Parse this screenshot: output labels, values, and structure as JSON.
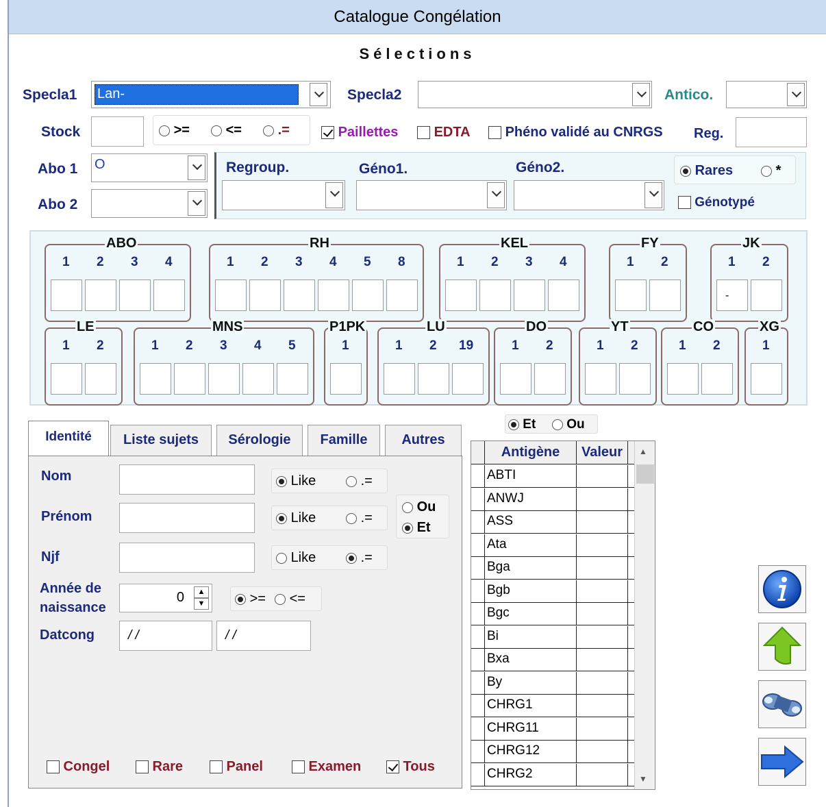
{
  "window": {
    "title": "Catalogue Congélation",
    "section_title": "Sélections"
  },
  "top": {
    "specla1_label": "Specla1",
    "specla1_value": "Lan-",
    "specla2_label": "Specla2",
    "specla2_value": "",
    "antico_label": "Antico.",
    "antico_value": "",
    "stock_label": "Stock",
    "cmp_ge": ">=",
    "cmp_le": "<=",
    "cmp_eq": ".=",
    "paillettes_label": "Paillettes",
    "paillettes_checked": true,
    "edta_label": "EDTA",
    "edta_checked": false,
    "pheno_label": "Phéno validé au CNRGS",
    "pheno_checked": false,
    "reg_label": "Reg.",
    "abo1_label": "Abo 1",
    "abo1_value": "O",
    "abo2_label": "Abo 2",
    "abo2_value": ""
  },
  "geno": {
    "regroup_label": "Regroup.",
    "geno1_label": "Géno1.",
    "geno2_label": "Géno2.",
    "rares_label": "Rares",
    "star_label": "*",
    "genotype_label": "Génotypé"
  },
  "groups_row1": [
    {
      "name": "ABO",
      "cols": [
        "1",
        "2",
        "3",
        "4"
      ]
    },
    {
      "name": "RH",
      "cols": [
        "1",
        "2",
        "3",
        "4",
        "5",
        "8"
      ]
    },
    {
      "name": "KEL",
      "cols": [
        "1",
        "2",
        "3",
        "4"
      ]
    },
    {
      "name": "FY",
      "cols": [
        "1",
        "2"
      ]
    },
    {
      "name": "JK",
      "cols": [
        "1",
        "2"
      ],
      "values": [
        "-",
        ""
      ]
    }
  ],
  "groups_row2": [
    {
      "name": "LE",
      "cols": [
        "1",
        "2"
      ]
    },
    {
      "name": "MNS",
      "cols": [
        "1",
        "2",
        "3",
        "4",
        "5"
      ]
    },
    {
      "name": "P1PK",
      "cols": [
        "1"
      ]
    },
    {
      "name": "LU",
      "cols": [
        "1",
        "2",
        "19"
      ]
    },
    {
      "name": "DO",
      "cols": [
        "1",
        "2"
      ]
    },
    {
      "name": "YT",
      "cols": [
        "1",
        "2"
      ]
    },
    {
      "name": "CO",
      "cols": [
        "1",
        "2"
      ]
    },
    {
      "name": "XG",
      "cols": [
        "1"
      ]
    }
  ],
  "tabs": [
    "Identité",
    "Liste sujets",
    "Sérologie",
    "Famille",
    "Autres"
  ],
  "identity": {
    "nom_label": "Nom",
    "prenom_label": "Prénom",
    "njf_label": "Njf",
    "annee_label_1": "Année de",
    "annee_label_2": "naissance",
    "annee_value": "0",
    "datcong_label": "Datcong",
    "datcong_from": "/ /",
    "datcong_to": "/ /",
    "like_label": "Like",
    "eq_label": ".=",
    "ou_label": "Ou",
    "et_label": "Et",
    "ge_label": ">=",
    "le_label": "<="
  },
  "bottom_checks": [
    {
      "label": "Congel",
      "checked": false
    },
    {
      "label": "Rare",
      "checked": false
    },
    {
      "label": "Panel",
      "checked": false
    },
    {
      "label": "Examen",
      "checked": false
    },
    {
      "label": "Tous",
      "checked": true
    }
  ],
  "antigen_grid": {
    "et_label": "Et",
    "ou_label": "Ou",
    "col1": "Antigène",
    "col2": "Valeur",
    "rows": [
      "ABTI",
      "ANWJ",
      "ASS",
      "Ata",
      "Bga",
      "Bgb",
      "Bgc",
      "Bi",
      "Bxa",
      "By",
      "CHRG1",
      "CHRG11",
      "CHRG12",
      "CHRG2"
    ]
  },
  "side_buttons": [
    "info-icon",
    "up-arrow-icon",
    "binoculars-icon",
    "right-arrow-icon"
  ],
  "colors": {
    "titlebar": "#c9dcf2",
    "selected": "#1f6fe0",
    "panel": "#eef8fa",
    "label": "#1b2a7a"
  }
}
